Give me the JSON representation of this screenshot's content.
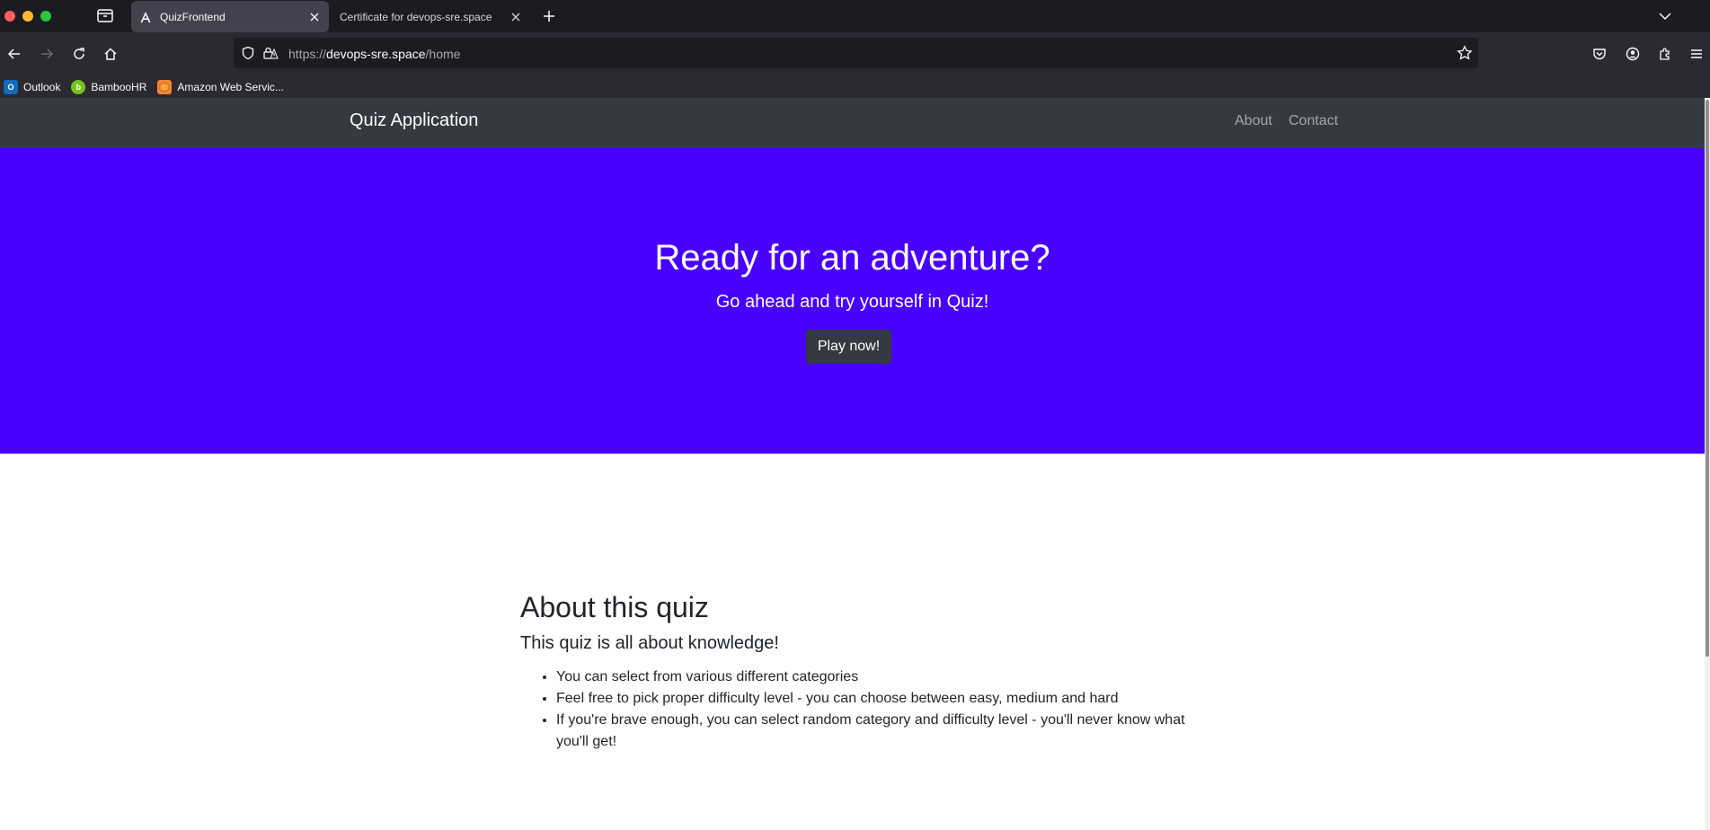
{
  "browser": {
    "tabs": [
      {
        "title": "QuizFrontend",
        "active": true,
        "favicon": "angular-icon"
      },
      {
        "title": "Certificate for devops-sre.space",
        "active": false
      }
    ],
    "url": {
      "scheme": "https://",
      "host": "devops-sre.space",
      "path": "/home"
    },
    "bookmarks": [
      {
        "label": "Outlook",
        "icon": "outlook-icon",
        "color": "#0f6cbd"
      },
      {
        "label": "BambooHR",
        "icon": "bamboohr-icon",
        "color": "#73c41d"
      },
      {
        "label": "Amazon Web Servic...",
        "icon": "aws-icon",
        "color": "#f58536"
      }
    ]
  },
  "site": {
    "brand": "Quiz Application",
    "nav": [
      {
        "label": "About"
      },
      {
        "label": "Contact"
      }
    ]
  },
  "hero": {
    "title": "Ready for an adventure?",
    "subtitle": "Go ahead and try yourself in Quiz!",
    "button": "Play now!",
    "background": "#4800ff"
  },
  "about": {
    "title": "About this quiz",
    "lead": "This quiz is all about knowledge!",
    "items": [
      "You can select from various different categories",
      "Feel free to pick proper difficulty level - you can choose between easy, medium and hard",
      "If you're brave enough, you can select random category and difficulty level - you'll never know what you'll get!"
    ]
  }
}
